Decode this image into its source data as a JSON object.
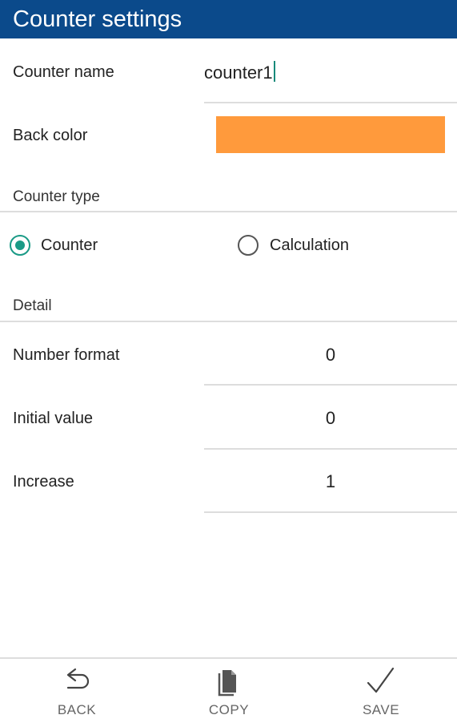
{
  "header": {
    "title": "Counter settings"
  },
  "form": {
    "counter_name_label": "Counter name",
    "counter_name_value": "counter1",
    "back_color_label": "Back color",
    "back_color_value": "#ff9a3c",
    "counter_type_label": "Counter type",
    "type_options": [
      {
        "label": "Counter",
        "selected": true
      },
      {
        "label": "Calculation",
        "selected": false
      }
    ],
    "detail_label": "Detail",
    "number_format_label": "Number format",
    "number_format_value": "0",
    "initial_value_label": "Initial value",
    "initial_value_value": "0",
    "increase_label": "Increase",
    "increase_value": "1"
  },
  "bottom_bar": {
    "back_label": "BACK",
    "copy_label": "COPY",
    "save_label": "SAVE"
  },
  "colors": {
    "header_bg": "#0b4a8b",
    "accent": "#1a9a86",
    "back_color": "#ff9a3c"
  }
}
